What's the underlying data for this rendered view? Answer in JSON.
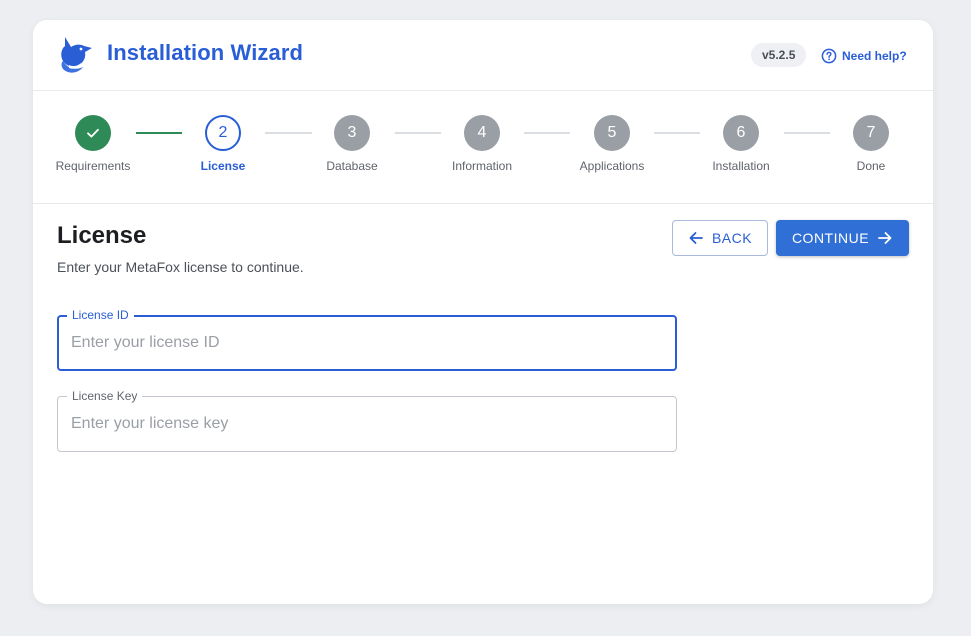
{
  "header": {
    "title": "Installation Wizard",
    "version": "v5.2.5",
    "help_label": "Need help?"
  },
  "steps": [
    {
      "number": "",
      "label": "Requirements",
      "status": "complete"
    },
    {
      "number": "2",
      "label": "License",
      "status": "active"
    },
    {
      "number": "3",
      "label": "Database",
      "status": "pending"
    },
    {
      "number": "4",
      "label": "Information",
      "status": "pending"
    },
    {
      "number": "5",
      "label": "Applications",
      "status": "pending"
    },
    {
      "number": "6",
      "label": "Installation",
      "status": "pending"
    },
    {
      "number": "7",
      "label": "Done",
      "status": "pending"
    }
  ],
  "main": {
    "title": "License",
    "subtitle": "Enter your MetaFox license to continue.",
    "back_label": "BACK",
    "continue_label": "CONTINUE"
  },
  "form": {
    "license_id": {
      "label": "License ID",
      "value": "",
      "placeholder": "Enter your license ID"
    },
    "license_key": {
      "label": "License Key",
      "value": "",
      "placeholder": "Enter your license key"
    }
  },
  "colors": {
    "accent": "#2a5ed6",
    "complete": "#2e8b57",
    "pending": "#9a9ea5",
    "button": "#2f6fd6"
  },
  "icons": {
    "logo": "fox-logo-icon",
    "help": "question-circle-icon",
    "complete_step": "check-icon",
    "back": "arrow-left-icon",
    "continue": "arrow-right-icon"
  }
}
